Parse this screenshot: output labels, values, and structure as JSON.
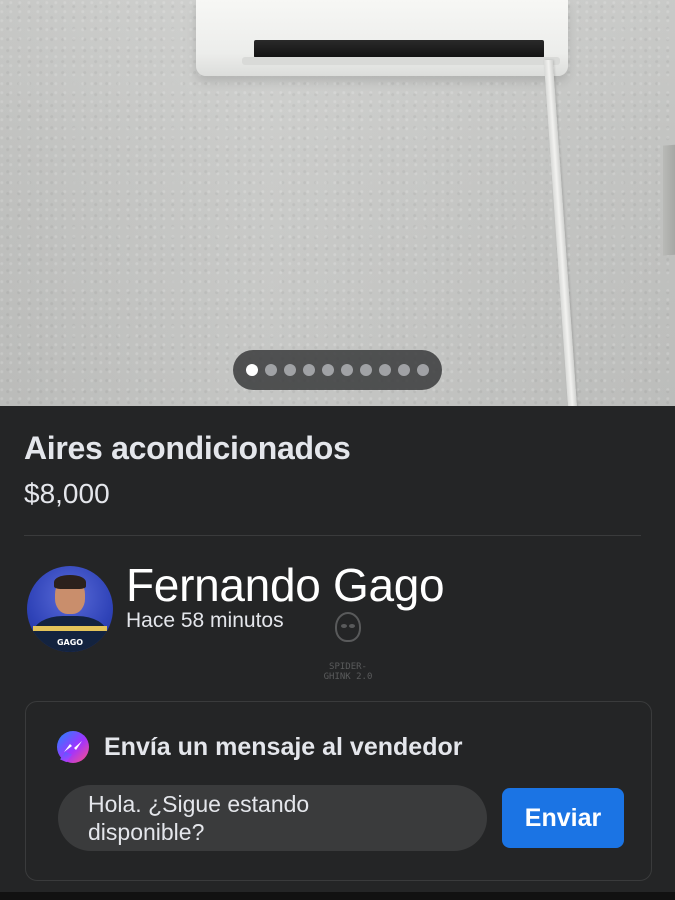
{
  "listing": {
    "title": "Aires acondicionados",
    "price": "$8,000"
  },
  "gallery": {
    "photo_count": 10,
    "active_index": 0
  },
  "seller": {
    "name": "Fernando Gago",
    "posted": "Hace 58 minutos",
    "avatar_tag": "GAGO"
  },
  "watermark": {
    "text": "SPIDER-GHINK 2.0"
  },
  "message": {
    "title": "Envía un mensaje al vendedor",
    "input_value": "Hola. ¿Sigue estando\ndisponible?",
    "send_label": "Enviar"
  },
  "colors": {
    "background": "#242526",
    "accent": "#1b74e4",
    "input_bg": "#3a3b3c"
  },
  "icons": {
    "messenger": "messenger-icon"
  }
}
